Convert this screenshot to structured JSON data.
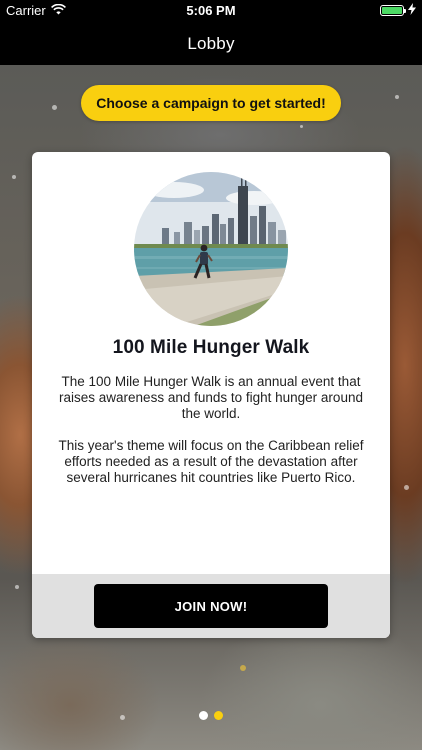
{
  "status_bar": {
    "carrier": "Carrier",
    "time": "5:06 PM",
    "battery_level": 1.0,
    "battery_color": "#4cd964"
  },
  "nav": {
    "title": "Lobby"
  },
  "banner": {
    "label": "Choose a campaign to get started!",
    "color": "#f9cf0f"
  },
  "campaign": {
    "image_icon": "city-lakefront-runner-photo",
    "title": "100 Mile Hunger Walk",
    "description_1": "The 100 Mile Hunger Walk is an annual event that raises awareness and funds to fight hunger around the world.",
    "description_2": "This year's theme will focus on the Caribbean relief efforts needed as a result of the devastation after several hurricanes hit countries like Puerto Rico.",
    "join_label": "JOIN NOW!"
  },
  "pager": {
    "count": 2,
    "active_index": 1,
    "active_color": "#f9cf0f",
    "inactive_color": "#ffffff"
  }
}
